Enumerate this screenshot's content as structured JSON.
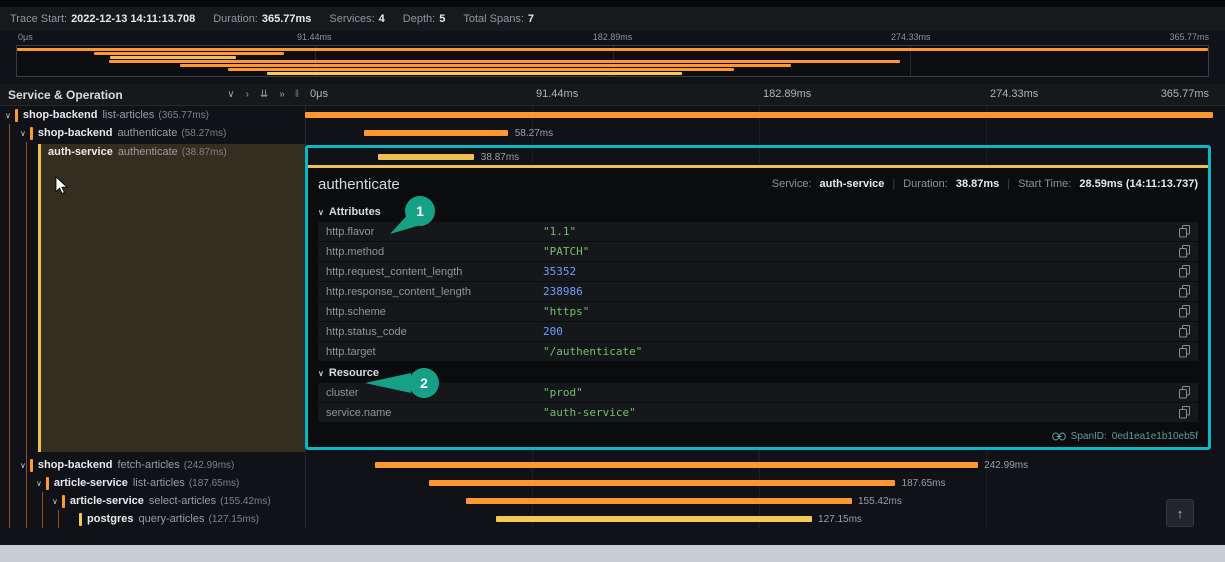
{
  "trace_header": {
    "items": [
      {
        "label": "Trace Start:",
        "value": "2022-12-13 14:11:13.708"
      },
      {
        "label": "Duration:",
        "value": "365.77ms"
      },
      {
        "label": "Services:",
        "value": "4"
      },
      {
        "label": "Depth:",
        "value": "5"
      },
      {
        "label": "Total Spans:",
        "value": "7"
      }
    ]
  },
  "minimap": {
    "ticks": [
      "0μs",
      "91.44ms",
      "182.89ms",
      "274.33ms",
      "365.77ms"
    ]
  },
  "timeline_header": {
    "title": "Service & Operation",
    "ticks": [
      "0μs",
      "91.44ms",
      "182.89ms",
      "274.33ms",
      "365.77ms"
    ]
  },
  "icons": {
    "collapse_one": "∨",
    "expand_one": "›",
    "collapse_all": "⇊",
    "expand_all": "»",
    "splitter": "‖",
    "tree_chevron": "∨",
    "section_chevron": "∨",
    "scroll_top": "↑"
  },
  "spans": [
    {
      "service": "shop-backend",
      "operation": "list-articles",
      "tree_duration": "(365.77ms)",
      "bar_label": "",
      "start": "0%",
      "width": "100%",
      "label_left": "0%",
      "color": "#ff9830"
    },
    {
      "service": "shop-backend",
      "operation": "authenticate",
      "tree_duration": "(58.27ms)",
      "bar_label": "58.27ms",
      "start": "6.5%",
      "width": "15.9%",
      "label_left": "23.1%",
      "color": "#ff9830"
    },
    {
      "service": "auth-service",
      "operation": "authenticate",
      "tree_duration": "(38.87ms)",
      "bar_label": "38.87ms",
      "start": "7.8%",
      "width": "10.6%",
      "label_left": "19.2%",
      "color": "#eec052"
    },
    {
      "service": "shop-backend",
      "operation": "fetch-articles",
      "tree_duration": "(242.99ms)",
      "bar_label": "242.99ms",
      "start": "7.7%",
      "width": "66.4%",
      "label_left": "74.8%",
      "color": "#ff9830"
    },
    {
      "service": "article-service",
      "operation": "list-articles",
      "tree_duration": "(187.65ms)",
      "bar_label": "187.65ms",
      "start": "13.7%",
      "width": "51.3%",
      "label_left": "65.7%",
      "color": "#ff9830"
    },
    {
      "service": "article-service",
      "operation": "select-articles",
      "tree_duration": "(155.42ms)",
      "bar_label": "155.42ms",
      "start": "17.7%",
      "width": "42.5%",
      "label_left": "60.9%",
      "color": "#ff9830"
    },
    {
      "service": "postgres",
      "operation": "query-articles",
      "tree_duration": "(127.15ms)",
      "bar_label": "127.15ms",
      "start": "21%",
      "width": "34.8%",
      "label_left": "56.5%",
      "color": "#f2cc52"
    }
  ],
  "detail": {
    "title": "authenticate",
    "meta": [
      {
        "label": "Service:",
        "value": "auth-service"
      },
      {
        "label": "Duration:",
        "value": "38.87ms"
      },
      {
        "label": "Start Time:",
        "value": "28.59ms (14:11:13.737)"
      }
    ],
    "meta_divider": "|",
    "attributes": {
      "title": "Attributes",
      "rows": [
        {
          "key": "http.flavor",
          "value": "\"1.1\"",
          "color": "#73bf69"
        },
        {
          "key": "http.method",
          "value": "\"PATCH\"",
          "color": "#73bf69"
        },
        {
          "key": "http.request_content_length",
          "value": "35352",
          "color": "#6e9fff"
        },
        {
          "key": "http.response_content_length",
          "value": "238986",
          "color": "#6e9fff"
        },
        {
          "key": "http.scheme",
          "value": "\"https\"",
          "color": "#73bf69"
        },
        {
          "key": "http.status_code",
          "value": "200",
          "color": "#6e9fff"
        },
        {
          "key": "http.target",
          "value": "\"/authenticate\"",
          "color": "#73bf69"
        }
      ]
    },
    "resource": {
      "title": "Resource",
      "rows": [
        {
          "key": "cluster",
          "value": "\"prod\"",
          "color": "#73bf69"
        },
        {
          "key": "service.name",
          "value": "\"auth-service\"",
          "color": "#73bf69"
        }
      ]
    },
    "span_id": {
      "label": "SpanID:",
      "value": "0ed1ea1e1b10eb5f"
    }
  },
  "annotations": {
    "color": "#16a085",
    "badges": [
      "1",
      "2"
    ]
  },
  "colors": {
    "highlight_box": "#0cb7c4",
    "selected_stripe": "#eec052"
  }
}
